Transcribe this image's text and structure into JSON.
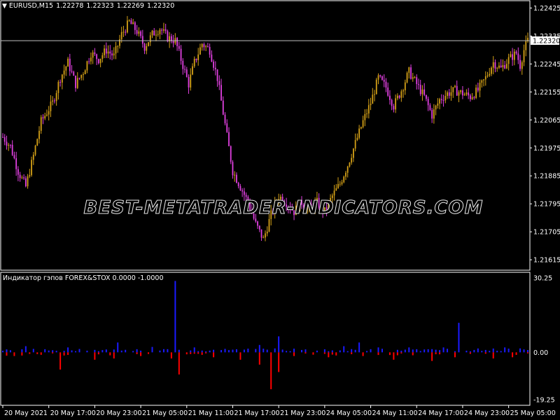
{
  "header": {
    "symbol": "EURUSD,M15",
    "open": "1.22278",
    "high": "1.22323",
    "low": "1.22269",
    "close": "1.22320",
    "dropdown_icon": "triangle-down-icon"
  },
  "watermark": "BEST-METATRADER-INDICATORS.COM",
  "indicator": {
    "title": "Индикатор гэпов FOREX&STOX 0.0000 -1.0000",
    "colors": {
      "up": "#1a1aff",
      "down": "#ff0000"
    }
  },
  "colors": {
    "background": "#000000",
    "axis_text": "#ffffff",
    "bull_candle": "#d4a017",
    "bear_candle": "#e040e0",
    "price_line": "#c0c0c0",
    "current_price_tag_bg": "#ffffff"
  },
  "chart_data": [
    {
      "type": "candlestick",
      "title": "EURUSD,M15",
      "yticks": [
        "1.22425",
        "1.22335",
        "1.22245",
        "1.22155",
        "1.22065",
        "1.21975",
        "1.21885",
        "1.21795",
        "1.21705",
        "1.21615"
      ],
      "ylim": [
        1.21595,
        1.22435
      ],
      "current_price": "1.22320",
      "close_path": [
        [
          0,
          1.2201
        ],
        [
          4,
          1.2198
        ],
        [
          8,
          1.219
        ],
        [
          12,
          1.2185
        ],
        [
          16,
          1.2195
        ],
        [
          20,
          1.2206
        ],
        [
          26,
          1.2212
        ],
        [
          30,
          1.222
        ],
        [
          34,
          1.2225
        ],
        [
          38,
          1.2218
        ],
        [
          42,
          1.2222
        ],
        [
          46,
          1.2228
        ],
        [
          50,
          1.2226
        ],
        [
          54,
          1.2229
        ],
        [
          58,
          1.2227
        ],
        [
          62,
          1.2234
        ],
        [
          66,
          1.2238
        ],
        [
          70,
          1.2235
        ],
        [
          74,
          1.223
        ],
        [
          78,
          1.2234
        ],
        [
          82,
          1.2236
        ],
        [
          86,
          1.2233
        ],
        [
          90,
          1.2232
        ],
        [
          94,
          1.2224
        ],
        [
          97,
          1.2218
        ],
        [
          100,
          1.2225
        ],
        [
          104,
          1.2231
        ],
        [
          108,
          1.2229
        ],
        [
          112,
          1.222
        ],
        [
          116,
          1.2205
        ],
        [
          120,
          1.219
        ],
        [
          124,
          1.2185
        ],
        [
          128,
          1.218
        ],
        [
          132,
          1.2173
        ],
        [
          136,
          1.2168
        ],
        [
          140,
          1.2176
        ],
        [
          144,
          1.2182
        ],
        [
          148,
          1.218
        ],
        [
          152,
          1.2177
        ],
        [
          156,
          1.218
        ],
        [
          160,
          1.2178
        ],
        [
          164,
          1.218
        ],
        [
          168,
          1.2177
        ],
        [
          172,
          1.2182
        ],
        [
          176,
          1.2186
        ],
        [
          180,
          1.2192
        ],
        [
          184,
          1.2199
        ],
        [
          188,
          1.2206
        ],
        [
          192,
          1.2212
        ],
        [
          196,
          1.222
        ],
        [
          200,
          1.2217
        ],
        [
          204,
          1.2211
        ],
        [
          208,
          1.2216
        ],
        [
          212,
          1.2222
        ],
        [
          216,
          1.2218
        ],
        [
          220,
          1.2214
        ],
        [
          224,
          1.2208
        ],
        [
          228,
          1.2213
        ],
        [
          232,
          1.2215
        ],
        [
          236,
          1.2216
        ],
        [
          240,
          1.2215
        ],
        [
          244,
          1.2214
        ],
        [
          248,
          1.2216
        ],
        [
          252,
          1.222
        ],
        [
          256,
          1.2225
        ],
        [
          260,
          1.2223
        ],
        [
          264,
          1.2226
        ],
        [
          268,
          1.2228
        ],
        [
          270,
          1.2224
        ],
        [
          272,
          1.2229
        ],
        [
          274,
          1.2232
        ]
      ]
    },
    {
      "type": "bar",
      "title": "Индикатор гэпов FOREX&STOX 0.0000 -1.0000",
      "yticks": [
        "30.25",
        "0.00",
        "-19.25"
      ],
      "ylim": [
        -19.25,
        30.25
      ],
      "up_spikes": [
        [
          12,
          2.5
        ],
        [
          34,
          2.0
        ],
        [
          60,
          4.0
        ],
        [
          78,
          2.2
        ],
        [
          90,
          29.0
        ],
        [
          100,
          2.0
        ],
        [
          128,
          1.5
        ],
        [
          134,
          3.0
        ],
        [
          144,
          6.5
        ],
        [
          152,
          1.5
        ],
        [
          178,
          2.5
        ],
        [
          186,
          4.0
        ],
        [
          196,
          2.0
        ],
        [
          212,
          2.0
        ],
        [
          230,
          2.0
        ],
        [
          238,
          12.0
        ],
        [
          262,
          2.0
        ]
      ],
      "down_spikes": [
        [
          6,
          -1.5
        ],
        [
          20,
          -1.0
        ],
        [
          30,
          -7.0
        ],
        [
          48,
          -3.0
        ],
        [
          58,
          -2.5
        ],
        [
          72,
          -1.5
        ],
        [
          88,
          -2.5
        ],
        [
          92,
          -9.0
        ],
        [
          110,
          -2.0
        ],
        [
          124,
          -3.0
        ],
        [
          134,
          -5.0
        ],
        [
          140,
          -15.0
        ],
        [
          144,
          -8.0
        ],
        [
          152,
          -1.5
        ],
        [
          170,
          -2.0
        ],
        [
          188,
          -1.5
        ],
        [
          204,
          -3.0
        ],
        [
          224,
          -3.5
        ],
        [
          236,
          -2.0
        ],
        [
          256,
          -2.5
        ],
        [
          266,
          -2.0
        ]
      ]
    }
  ],
  "xaxis": {
    "labels": [
      "20 May 2021",
      "20 May 17:00",
      "20 May 23:00",
      "21 May 05:00",
      "21 May 11:00",
      "21 May 17:00",
      "21 May 23:00",
      "24 May 05:00",
      "24 May 11:00",
      "24 May 17:00",
      "24 May 23:00",
      "25 May 05:00"
    ],
    "label_bars": [
      0,
      24,
      48,
      72,
      96,
      120,
      144,
      168,
      192,
      216,
      240,
      264
    ]
  }
}
